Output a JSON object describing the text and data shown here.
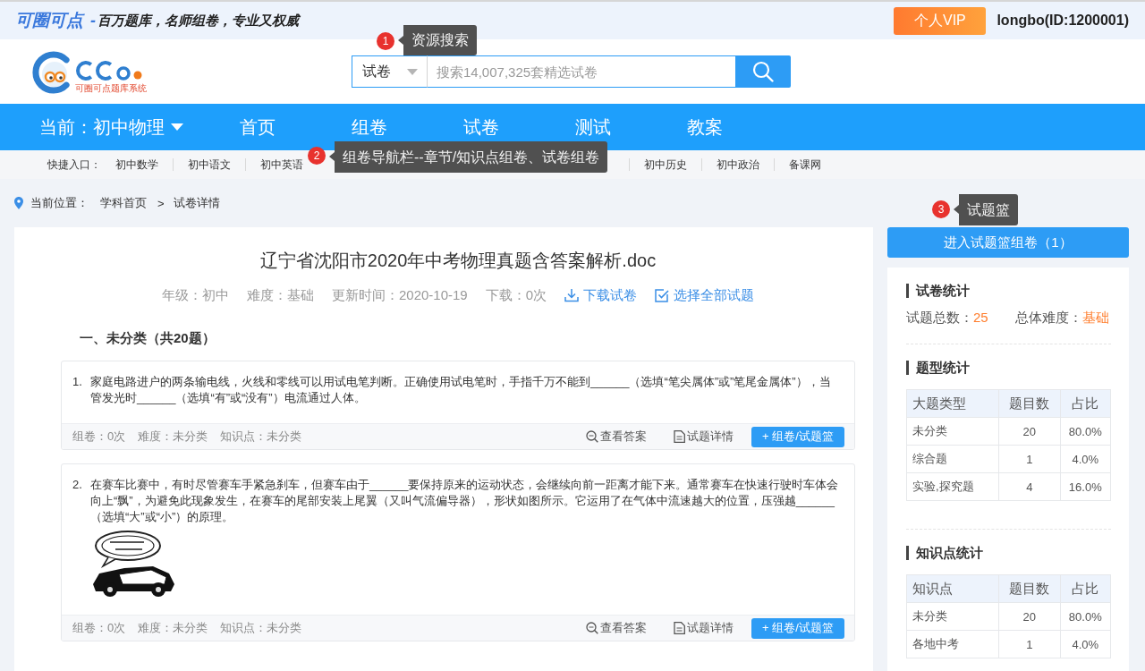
{
  "top_bar": {
    "brand": "可圈可点",
    "dash": "-",
    "slogan": "百万题库，名师组卷，专业又权威",
    "vip_button": "个人VIP",
    "user": "longbo(ID:1200001)"
  },
  "header": {
    "logo_caption": "可圈可点题库系统",
    "search": {
      "scope": "试卷",
      "placeholder": "搜索14,007,325套精选试卷"
    }
  },
  "nav": {
    "current": "当前：初中物理",
    "items": [
      "首页",
      "组卷",
      "试卷",
      "测试",
      "教案"
    ]
  },
  "quick_links": {
    "label": "快捷入口：",
    "groups": [
      [
        "初中数学",
        "初中语文",
        "初中英语"
      ],
      [
        "初中历史",
        "初中政治",
        "备课网"
      ]
    ]
  },
  "breadcrumb": {
    "label": "当前位置：",
    "separator": ">",
    "items": [
      "学科首页",
      "试卷详情"
    ]
  },
  "paper": {
    "title": "辽宁省沈阳市2020年中考物理真题含答案解析.doc",
    "meta": [
      "年级：初中",
      "难度：基础",
      "更新时间：2020-10-19",
      "下载：0次"
    ],
    "actions": [
      {
        "kind": "download",
        "label": "下载试卷"
      },
      {
        "kind": "select_all",
        "label": "选择全部试题"
      }
    ],
    "sections": [
      {
        "heading": "一、未分类（共20题）",
        "questions": [
          {
            "number": "1.",
            "text": "家庭电路进户的两条输电线，火线和零线可以用试电笔判断。正确使用试电笔时，手指千万不能到______（选填“笔尖属体”或”笔尾金属体”），当管发光时______（选填“有”或“没有”）电流通过人体。",
            "figure": false,
            "info": [
              "组卷：0次",
              "难度：未分类",
              "知识点：未分类"
            ],
            "actions": [
              {
                "kind": "answer",
                "label": "查看答案"
              },
              {
                "kind": "detail",
                "label": "试题详情"
              },
              {
                "kind": "add",
                "label": "+ 组卷/试题篮"
              }
            ]
          },
          {
            "number": "2.",
            "text": "在赛车比赛中，有时尽管赛车手紧急刹车，但赛车由于______要保持原来的运动状态，会继续向前一距离才能下来。通常赛车在快速行驶时车体会向上“飘”，为避免此现象发生，在赛车的尾部安装上尾翼（又叫气流偏导器），形状如图所示。它运用了在气体中流速越大的位置，压强越______（选填“大”或“小”）的原理。",
            "figure": true,
            "info": [
              "组卷：0次",
              "难度：未分类",
              "知识点：未分类"
            ],
            "actions": [
              {
                "kind": "answer",
                "label": "查看答案"
              },
              {
                "kind": "detail",
                "label": "试题详情"
              },
              {
                "kind": "add",
                "label": "+ 组卷/试题篮"
              }
            ]
          }
        ]
      }
    ]
  },
  "sidebar": {
    "basket_button": "进入试题篮组卷（1）",
    "summary": {
      "title": "试卷统计",
      "items": [
        {
          "label": "试题总数：",
          "value": "25"
        },
        {
          "label": "总体难度：",
          "value": "基础"
        }
      ]
    },
    "tables": [
      {
        "title": "题型统计",
        "columns": [
          "大题类型",
          "题目数",
          "占比"
        ],
        "rows": [
          [
            "未分类",
            "20",
            "80.0%"
          ],
          [
            "综合题",
            "1",
            "4.0%"
          ],
          [
            "实验,探究题",
            "4",
            "16.0%"
          ]
        ]
      },
      {
        "title": "知识点统计",
        "columns": [
          "知识点",
          "题目数",
          "占比"
        ],
        "rows": [
          [
            "未分类",
            "20",
            "80.0%"
          ],
          [
            "各地中考",
            "1",
            "4.0%"
          ]
        ]
      }
    ]
  },
  "annotations": [
    {
      "number": "1",
      "text": "资源搜索"
    },
    {
      "number": "2",
      "text": "组卷导航栏--章节/知识点组卷、试卷组卷"
    },
    {
      "number": "3",
      "text": "试题篮"
    }
  ]
}
